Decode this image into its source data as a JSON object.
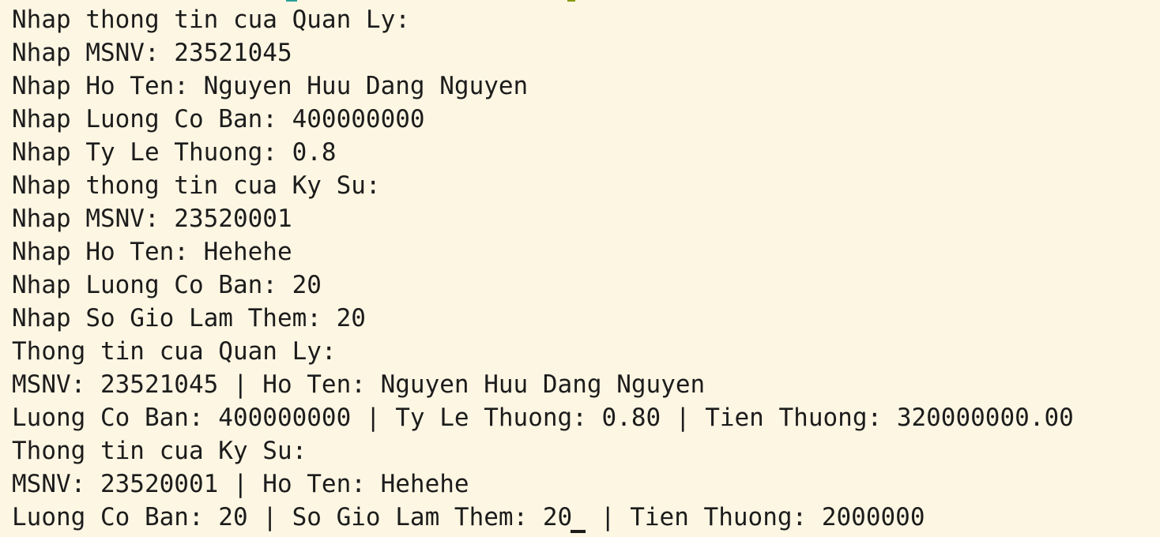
{
  "terminal": {
    "lines": [
      "Nhap thong tin cua Quan Ly:",
      "Nhap MSNV: 23521045",
      "Nhap Ho Ten: Nguyen Huu Dang Nguyen",
      "Nhap Luong Co Ban: 400000000",
      "Nhap Ty Le Thuong: 0.8",
      "Nhap thong tin cua Ky Su:",
      "Nhap MSNV: 23520001",
      "Nhap Ho Ten: Hehehe",
      "Nhap Luong Co Ban: 20",
      "Nhap So Gio Lam Them: 20",
      "Thong tin cua Quan Ly:",
      "MSNV: 23521045 | Ho Ten: Nguyen Huu Dang Nguyen",
      "Luong Co Ban: 400000000 | Ty Le Thuong: 0.80 | Tien Thuong: 320000000.00",
      "Thong tin cua Ky Su:",
      "MSNV: 23520001 | Ho Ten: Hehehe"
    ],
    "last_line_before_cursor": "Luong Co Ban: 20 | So Gio Lam Them: 20",
    "last_line_after_cursor": "| Tien Thuong: 2000000"
  },
  "colors": {
    "background": "#fdf6e3",
    "text": "#1c1c1c"
  }
}
